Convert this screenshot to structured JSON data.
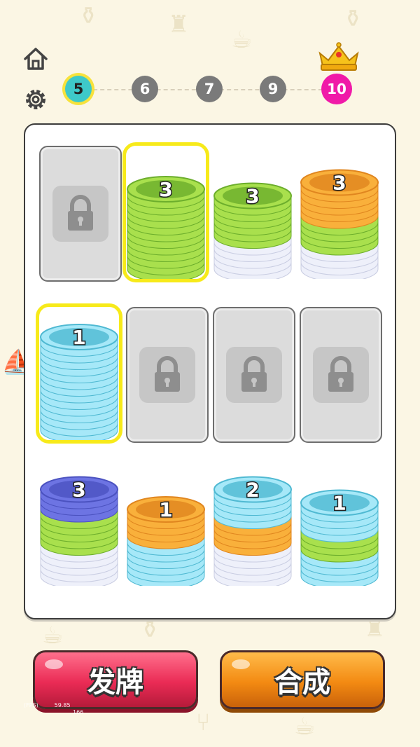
{
  "header": {
    "home_icon": "home-icon",
    "settings_icon": "gear-icon",
    "goal_icon": "crown-icon"
  },
  "levels": [
    {
      "label": "5",
      "state": "current"
    },
    {
      "label": "6",
      "state": "locked"
    },
    {
      "label": "7",
      "state": "locked"
    },
    {
      "label": "9",
      "state": "locked"
    },
    {
      "label": "10",
      "state": "goal"
    }
  ],
  "colors": {
    "green": "#a9e04d",
    "green_dark": "#6cae2c",
    "cyan": "#a6e8f8",
    "cyan_dark": "#4fb9d2",
    "orange": "#f9b03b",
    "orange_dark": "#e0861f",
    "blue": "#6d74e3",
    "white_plate": "#eef0fa",
    "selected_outline": "#f7ea1a"
  },
  "board": {
    "slots": [
      {
        "locked": true
      },
      {
        "locked": false,
        "selected": true,
        "plates": [
          {
            "color": "green",
            "count": 12
          }
        ],
        "top_label": "3"
      },
      {
        "locked": false,
        "plates": [
          {
            "color": "white",
            "count": 5
          },
          {
            "color": "green",
            "count": 6
          }
        ],
        "top_label": "3"
      },
      {
        "locked": false,
        "plates": [
          {
            "color": "white",
            "count": 4
          },
          {
            "color": "green",
            "count": 4
          },
          {
            "color": "orange",
            "count": 5
          }
        ],
        "top_label": "3"
      },
      {
        "locked": false,
        "selected": true,
        "plates": [
          {
            "color": "cyan",
            "count": 14
          }
        ],
        "top_label": "1"
      },
      {
        "locked": true
      },
      {
        "locked": true
      },
      {
        "locked": true
      },
      {
        "locked": false,
        "plates": [
          {
            "color": "white",
            "count": 5
          },
          {
            "color": "green",
            "count": 5
          },
          {
            "color": "blue",
            "count": 3
          }
        ],
        "top_label": "3"
      },
      {
        "locked": false,
        "plates": [
          {
            "color": "cyan",
            "count": 6
          },
          {
            "color": "orange",
            "count": 4
          }
        ],
        "top_label": "1"
      },
      {
        "locked": false,
        "plates": [
          {
            "color": "white",
            "count": 5
          },
          {
            "color": "orange",
            "count": 4
          },
          {
            "color": "cyan",
            "count": 4
          }
        ],
        "top_label": "2"
      },
      {
        "locked": false,
        "plates": [
          {
            "color": "cyan",
            "count": 4
          },
          {
            "color": "green",
            "count": 3
          },
          {
            "color": "cyan",
            "count": 4
          }
        ],
        "top_label": "1"
      }
    ]
  },
  "buttons": {
    "deal_label": "发牌",
    "merge_label": "合成"
  },
  "debug": {
    "line1_left": "(FPS)",
    "line1_right": "59.85",
    "line2_right": "166"
  }
}
